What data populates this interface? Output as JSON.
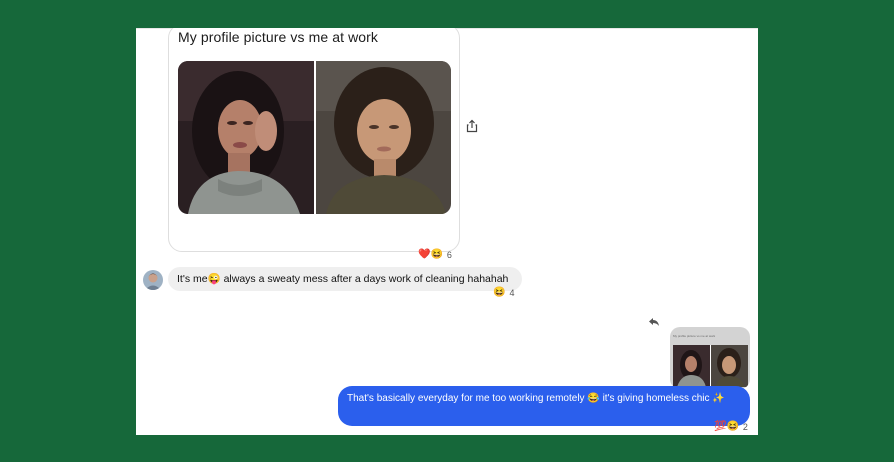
{
  "post": {
    "title": "My profile picture vs me at work",
    "reactions": {
      "emojis": "❤️😆",
      "count": "6"
    }
  },
  "message_in": {
    "text": "It's me😜 always a sweaty mess after a days work of cleaning hahahah",
    "reactions": {
      "emojis": "😆",
      "count": "4"
    }
  },
  "shared_preview": {
    "title": "My profile picture vs me at work"
  },
  "message_out": {
    "text": "That's basically everyday for me too working remotely 😂 it's giving homeless chic ✨",
    "reactions": {
      "emojis": "💯😆",
      "count": "2"
    }
  },
  "icons": {
    "share": "share-icon",
    "reply": "reply-icon",
    "avatar": "avatar"
  },
  "colors": {
    "background": "#16683a",
    "outgoing_bubble": "#2b5fed",
    "incoming_bubble": "#efefef"
  }
}
